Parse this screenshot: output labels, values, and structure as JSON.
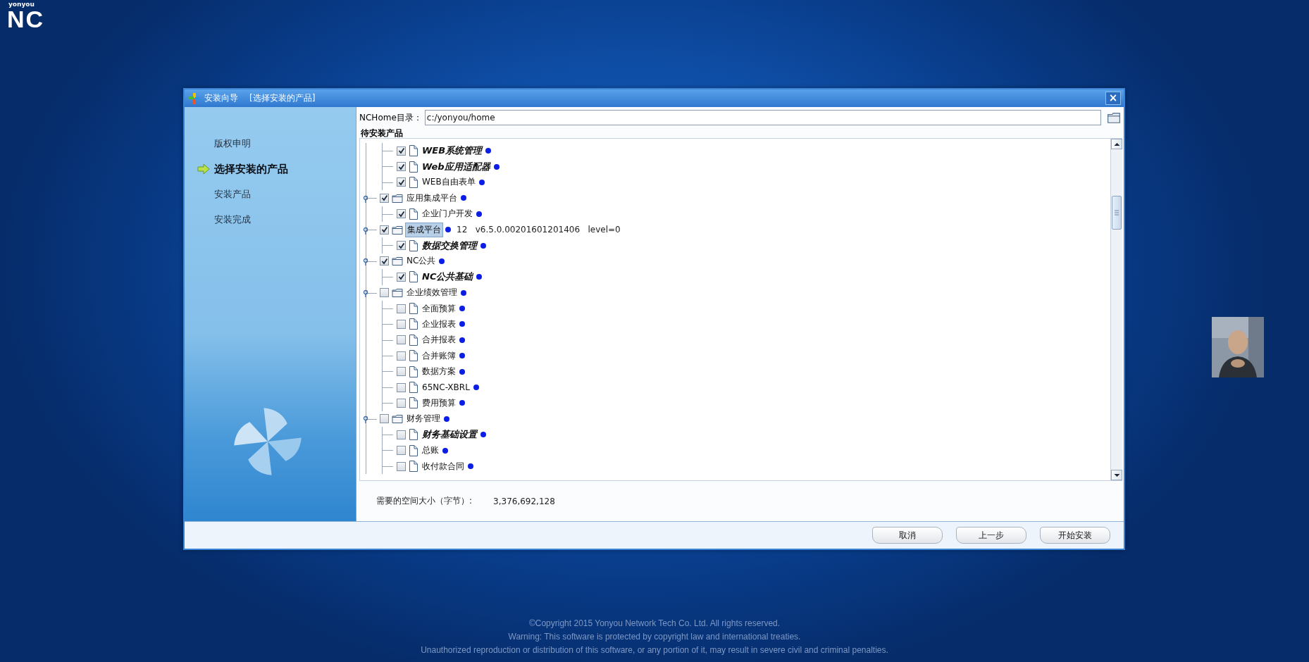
{
  "desktop_logo": {
    "brand": "yonyou",
    "product": "NC"
  },
  "dialog": {
    "title": "安装向导",
    "subtitle": "[选择安装的产品]",
    "close": "×"
  },
  "steps": [
    {
      "label": "版权申明",
      "selected": false
    },
    {
      "label": "选择安装的产品",
      "selected": true
    },
    {
      "label": "安装产品",
      "selected": false
    },
    {
      "label": "安装完成",
      "selected": false
    }
  ],
  "nchome": {
    "label": "NCHome目录：",
    "value": "c:/yonyou/home"
  },
  "products": {
    "title": "待安装产品",
    "tree": [
      {
        "children": [
          {
            "label": "WEB系统管理",
            "kind": "file",
            "checked": true,
            "bold": true,
            "selected": false
          },
          {
            "label": "Web应用适配器",
            "kind": "file",
            "checked": true,
            "bold": true,
            "selected": false
          },
          {
            "label": "WEB自由表单",
            "kind": "file",
            "checked": true,
            "bold": false,
            "selected": false
          }
        ]
      },
      {
        "label": "应用集成平台",
        "kind": "folder",
        "checked": true,
        "bold": false,
        "selected": false,
        "children": [
          {
            "label": "企业门户开发",
            "kind": "file",
            "checked": true,
            "bold": false,
            "selected": false
          }
        ]
      },
      {
        "label": "集成平台",
        "kind": "folder",
        "checked": true,
        "bold": false,
        "selected": true,
        "detail": "12   v6.5.0.00201601201406   level=0",
        "children": [
          {
            "label": "数据交换管理",
            "kind": "file",
            "checked": true,
            "bold": true,
            "selected": false
          }
        ]
      },
      {
        "label": "NC公共",
        "kind": "folder",
        "checked": true,
        "bold": false,
        "selected": false,
        "children": [
          {
            "label": "NC公共基础",
            "kind": "file",
            "checked": true,
            "bold": true,
            "selected": false
          }
        ]
      },
      {
        "label": "企业绩效管理",
        "kind": "folder",
        "checked": false,
        "bold": false,
        "selected": false,
        "children": [
          {
            "label": "全面预算",
            "kind": "file",
            "checked": false,
            "bold": false,
            "selected": false
          },
          {
            "label": "企业报表",
            "kind": "file",
            "checked": false,
            "bold": false,
            "selected": false
          },
          {
            "label": "合并报表",
            "kind": "file",
            "checked": false,
            "bold": false,
            "selected": false
          },
          {
            "label": "合并账簿",
            "kind": "file",
            "checked": false,
            "bold": false,
            "selected": false
          },
          {
            "label": "数据方案",
            "kind": "file",
            "checked": false,
            "bold": false,
            "selected": false
          },
          {
            "label": "65NC-XBRL",
            "kind": "file",
            "checked": false,
            "bold": false,
            "selected": false
          },
          {
            "label": "费用预算",
            "kind": "file",
            "checked": false,
            "bold": false,
            "selected": false
          }
        ]
      },
      {
        "label": "财务管理",
        "kind": "folder",
        "checked": false,
        "bold": false,
        "selected": false,
        "children": [
          {
            "label": "财务基础设置",
            "kind": "file",
            "checked": false,
            "bold": true,
            "selected": false
          },
          {
            "label": "总账",
            "kind": "file",
            "checked": false,
            "bold": false,
            "selected": false
          },
          {
            "label": "收付款合同",
            "kind": "file",
            "checked": false,
            "bold": false,
            "selected": false
          }
        ]
      }
    ]
  },
  "space": {
    "label": "需要的空间大小（字节）:",
    "value": "3,376,692,128"
  },
  "buttons": [
    "取消",
    "上一步",
    "开始安装"
  ],
  "copyright": [
    "©Copyright 2015 Yonyou Network Tech Co. Ltd. All rights reserved.",
    "Warning: This software is protected by copyright law and international treaties.",
    "Unauthorized reproduction or distribution of this software, or any portion of it, may result in severe civil and criminal penalties."
  ],
  "webcam": {
    "kind": "picture"
  }
}
